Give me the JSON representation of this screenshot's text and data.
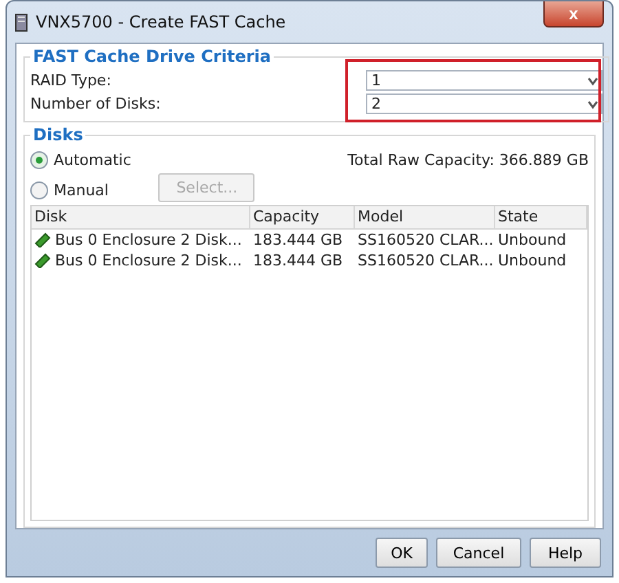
{
  "window": {
    "title": "VNX5700 - Create FAST Cache",
    "close": "x"
  },
  "criteria": {
    "title": "FAST Cache Drive Criteria",
    "fields": [
      {
        "label": "RAID Type:",
        "value": "1"
      },
      {
        "label": "Number of Disks:",
        "value": "2"
      }
    ],
    "highlighted": true
  },
  "disks": {
    "title": "Disks",
    "options": [
      {
        "label": "Automatic",
        "selected": true
      },
      {
        "label": "Manual",
        "selected": false
      }
    ],
    "select_button": {
      "label": "Select...",
      "disabled": true
    },
    "total": "Total Raw Capacity: 366.889 GB",
    "table": {
      "columns": [
        "Disk",
        "Capacity",
        "Model",
        "State"
      ],
      "rows": [
        [
          "Bus 0 Enclosure 2 Disk...",
          "183.444 GB",
          "SS160520 CLAR...",
          "Unbound"
        ],
        [
          "Bus 0 Enclosure 2 Disk...",
          "183.444 GB",
          "SS160520 CLAR...",
          "Unbound"
        ]
      ]
    }
  },
  "buttons": [
    "OK",
    "Cancel",
    "Help"
  ]
}
